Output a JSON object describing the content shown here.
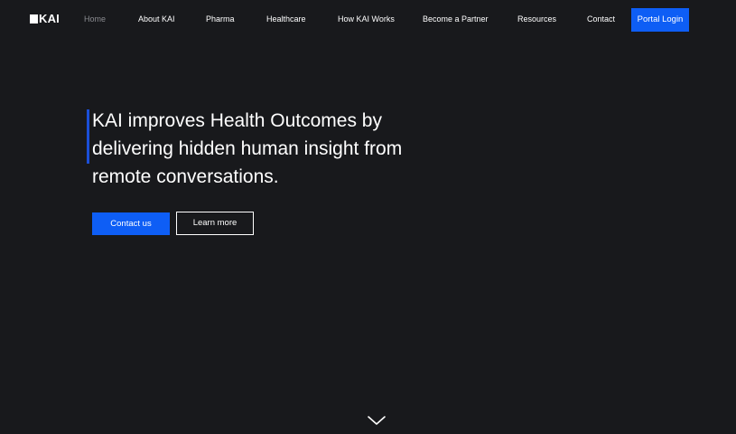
{
  "brand": {
    "logo_text": "KAI"
  },
  "nav": {
    "items": [
      {
        "label": "Home",
        "active": true
      },
      {
        "label": "About KAI"
      },
      {
        "label": "Pharma"
      },
      {
        "label": "Healthcare"
      },
      {
        "label": "How KAI Works"
      },
      {
        "label": "Become a Partner"
      },
      {
        "label": "Resources"
      },
      {
        "label": "Contact"
      }
    ],
    "portal_login": "Portal Login"
  },
  "hero": {
    "title": "KAI improves Health Outcomes by delivering hidden human insight from remote conversations.",
    "primary_cta": "Contact us",
    "secondary_cta": "Learn more"
  },
  "icons": {
    "scroll": "chevron-down-icon"
  },
  "colors": {
    "background": "#18191c",
    "accent": "#0e5ef5",
    "hero_bar": "#1b4fd8",
    "nav_active": "#8a8b90",
    "text": "#ffffff"
  }
}
